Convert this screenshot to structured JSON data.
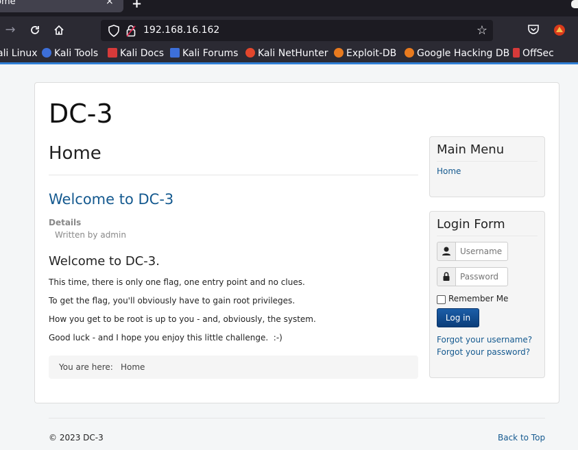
{
  "browser": {
    "tab_title": "ome",
    "tab_close": "×",
    "new_tab": "+",
    "url": "192.168.16.162",
    "bookmarks": [
      {
        "label": "ali Linux",
        "color": "#2b2a33"
      },
      {
        "label": "Kali Tools",
        "color": "#3d6fd9"
      },
      {
        "label": "Kali Docs",
        "color": "#d63a3a"
      },
      {
        "label": "Kali Forums",
        "color": "#3d6fd9"
      },
      {
        "label": "Kali NetHunter",
        "color": "#e2462c"
      },
      {
        "label": "Exploit-DB",
        "color": "#e87a1e"
      },
      {
        "label": "Google Hacking DB",
        "color": "#e87a1e"
      },
      {
        "label": "OffSec",
        "color": "#d63a3a"
      }
    ]
  },
  "site": {
    "title": "DC-3",
    "page_heading": "Home",
    "article_title": "Welcome to DC-3",
    "details_label": "Details",
    "written_by": "Written by admin",
    "welcome_heading": "Welcome to DC-3.",
    "paragraphs": [
      "This time, there is only one flag, one entry point and no clues.",
      "To get the flag, you'll obviously have to gain root privileges.",
      "How you get to be root is up to you - and, obviously, the system.",
      "Good luck - and I hope you enjoy this little challenge.  :-)"
    ],
    "breadcrumb_label": "You are here:",
    "breadcrumb_home": "Home"
  },
  "main_menu": {
    "title": "Main Menu",
    "items": [
      "Home"
    ]
  },
  "login_form": {
    "title": "Login Form",
    "username_placeholder": "Username",
    "password_placeholder": "Password",
    "remember_label": "Remember Me",
    "login_label": "Log in",
    "forgot_username": "Forgot your username?",
    "forgot_password": "Forgot your password?"
  },
  "footer": {
    "copyright": "© 2023 DC-3",
    "back_to_top": "Back to Top"
  },
  "colors": {
    "link": "#14598f",
    "accent": "#2f7fd6",
    "button": "#1b5ea8"
  }
}
